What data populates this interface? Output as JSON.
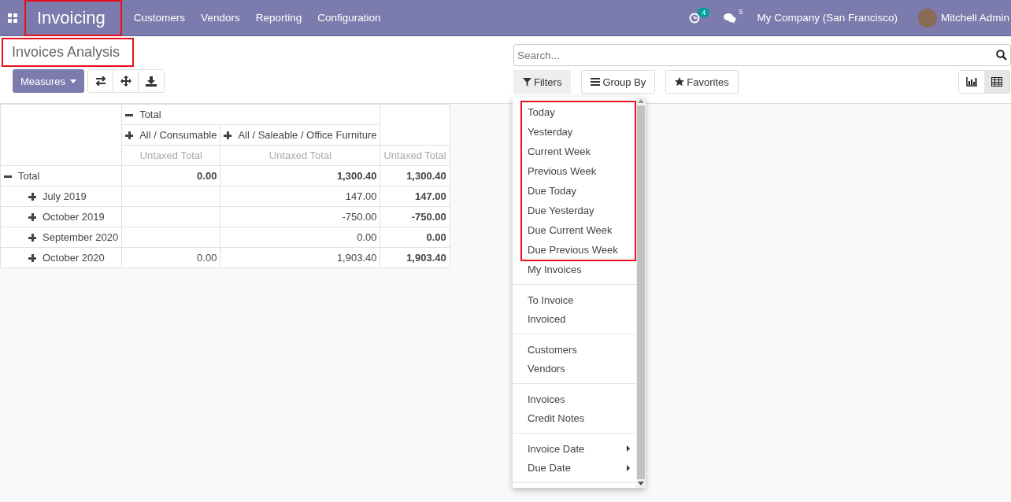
{
  "navbar": {
    "app_name": "Invoicing",
    "app_name_highlighted": true,
    "menu": [
      "Customers",
      "Vendors",
      "Reporting",
      "Configuration"
    ],
    "activity_count": "4",
    "message_count": "5",
    "company": "My Company (San Francisco)",
    "user": "Mitchell Admin"
  },
  "page": {
    "title": "Invoices Analysis",
    "title_highlighted": true,
    "measures_button": "Measures"
  },
  "search": {
    "placeholder": "Search..."
  },
  "search_buttons": [
    {
      "kind": "filter",
      "label": "Filters",
      "selected": true
    },
    {
      "kind": "group",
      "label": "Group By",
      "selected": false
    },
    {
      "kind": "favorite",
      "label": "Favorites",
      "selected": false
    }
  ],
  "view_switcher": [
    {
      "kind": "graph",
      "selected": false
    },
    {
      "kind": "pivot",
      "selected": true
    }
  ],
  "pivot": {
    "column_header": {
      "label": "Total",
      "expanded": true,
      "children": [
        {
          "label": "All / Consumable",
          "expanded": false
        },
        {
          "label": "All / Saleable / Office Furniture",
          "expanded": false
        }
      ]
    },
    "measures": [
      "Untaxed Total",
      "Untaxed Total",
      "Untaxed Total"
    ],
    "rows": [
      {
        "label": "Total",
        "expanded": true,
        "cells": [
          "0.00",
          "1,300.40",
          "1,300.40"
        ],
        "children": [
          {
            "label": "July 2019",
            "expanded": false,
            "cells": [
              "",
              "147.00",
              "147.00"
            ]
          },
          {
            "label": "October 2019",
            "expanded": false,
            "cells": [
              "",
              "-750.00",
              "-750.00"
            ]
          },
          {
            "label": "September 2020",
            "expanded": false,
            "cells": [
              "",
              "0.00",
              "0.00"
            ]
          },
          {
            "label": "October 2020",
            "expanded": false,
            "cells": [
              "0.00",
              "1,903.40",
              "1,903.40"
            ]
          }
        ]
      }
    ]
  },
  "filter_menu": {
    "groups": [
      {
        "highlighted": true,
        "divider_before": false,
        "items": [
          {
            "label": "Today",
            "submenu": false
          },
          {
            "label": "Yesterday",
            "submenu": false
          },
          {
            "label": "Current Week",
            "submenu": false
          },
          {
            "label": "Previous Week",
            "submenu": false
          },
          {
            "label": "Due Today",
            "submenu": false
          },
          {
            "label": "Due Yesterday",
            "submenu": false
          },
          {
            "label": "Due Current Week",
            "submenu": false
          },
          {
            "label": "Due Previous Week",
            "submenu": false
          }
        ]
      },
      {
        "highlighted": false,
        "divider_before": false,
        "items": [
          {
            "label": "My Invoices",
            "submenu": false
          }
        ]
      },
      {
        "highlighted": false,
        "divider_before": true,
        "items": [
          {
            "label": "To Invoice",
            "submenu": false
          },
          {
            "label": "Invoiced",
            "submenu": false
          }
        ]
      },
      {
        "highlighted": false,
        "divider_before": true,
        "items": [
          {
            "label": "Customers",
            "submenu": false
          },
          {
            "label": "Vendors",
            "submenu": false
          }
        ]
      },
      {
        "highlighted": false,
        "divider_before": true,
        "items": [
          {
            "label": "Invoices",
            "submenu": false
          },
          {
            "label": "Credit Notes",
            "submenu": false
          }
        ]
      },
      {
        "highlighted": false,
        "divider_before": true,
        "items": [
          {
            "label": "Invoice Date",
            "submenu": true
          },
          {
            "label": "Due Date",
            "submenu": true
          }
        ]
      }
    ]
  }
}
